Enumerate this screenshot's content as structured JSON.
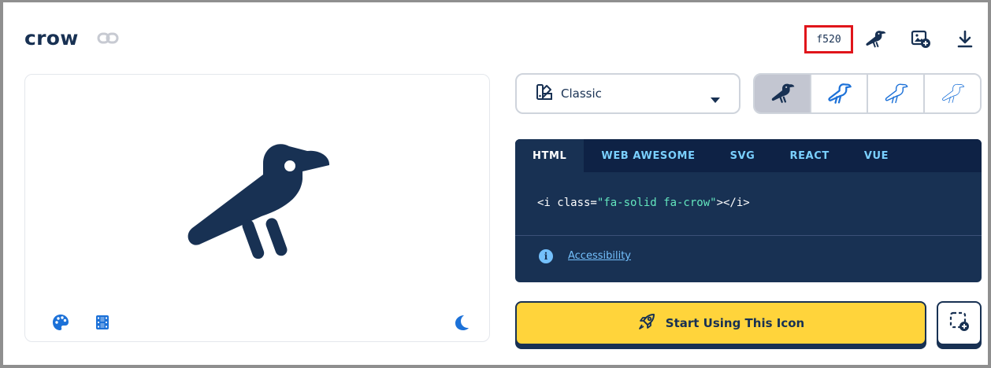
{
  "header": {
    "title": "crow",
    "unicode": "f520"
  },
  "style_select": {
    "value": "Classic"
  },
  "code": {
    "tabs": [
      "HTML",
      "WEB AWESOME",
      "SVG",
      "REACT",
      "VUE"
    ],
    "active_tab": "HTML",
    "snippet_open": "<i class=",
    "snippet_string": "\"fa-solid fa-crow\"",
    "snippet_close": "></i>",
    "accessibility_label": "Accessibility"
  },
  "actions": {
    "start_label": "Start Using This Icon"
  },
  "colors": {
    "navy": "#183153",
    "accent_yellow": "#ffd43b",
    "link_blue": "#74c0fc",
    "highlight_red": "#e0151b"
  },
  "icons": {
    "link": "link-icon",
    "crow": "crow-icon",
    "image_add": "image-plus-icon",
    "download": "download-icon",
    "palette": "palette-icon",
    "film": "film-icon",
    "moon": "moon-icon",
    "style_swatch": "swatchbook-icon",
    "caret": "caret-down-icon",
    "info": "info-icon",
    "rocket": "rocket-icon",
    "add_square": "square-plus-icon"
  }
}
